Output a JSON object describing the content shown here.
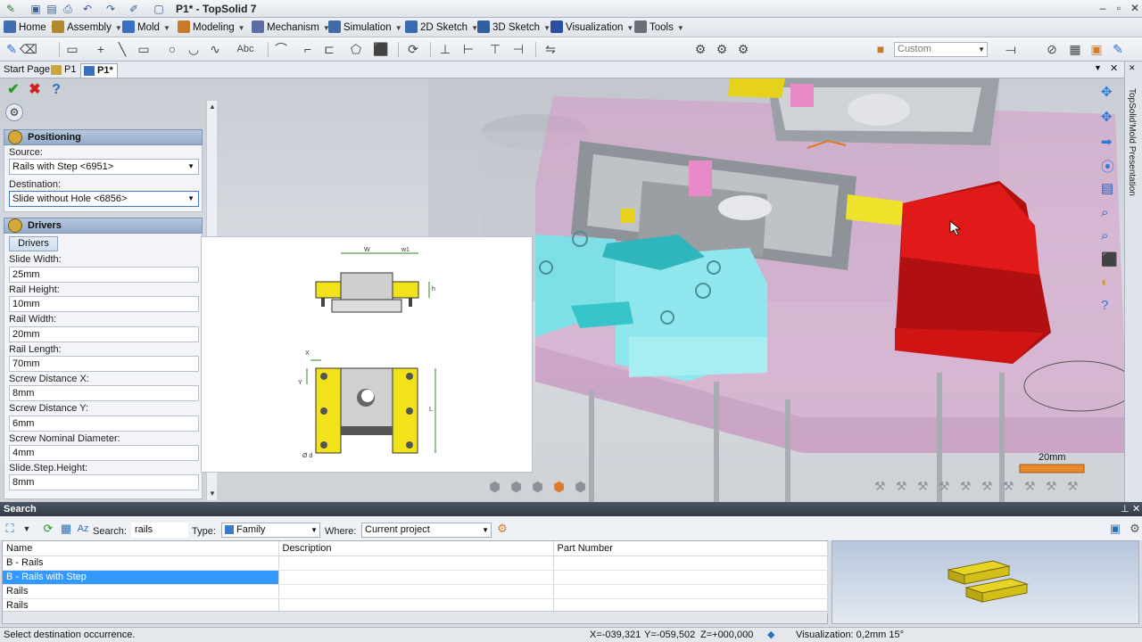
{
  "window": {
    "title": "P1* - TopSolid 7"
  },
  "menu": [
    {
      "label": "Home",
      "color": "#3f6fb0"
    },
    {
      "label": "Assembly",
      "color": "#b08a2c"
    },
    {
      "label": "Mold",
      "color": "#3a6fc2"
    },
    {
      "label": "Modeling",
      "color": "#c77a2a"
    },
    {
      "label": "Mechanism",
      "color": "#5a6fa6"
    },
    {
      "label": "Simulation",
      "color": "#406aa8"
    },
    {
      "label": "2D Sketch",
      "color": "#3a6ab0"
    },
    {
      "label": "3D Sketch",
      "color": "#2f5f9f"
    },
    {
      "label": "Visualization",
      "color": "#2a4ea0"
    },
    {
      "label": "Tools",
      "color": "#6a6f78"
    }
  ],
  "toolbar": {
    "view_style": "Custom"
  },
  "tabs": [
    {
      "label": "Start Page",
      "active": false
    },
    {
      "label": "P1",
      "active": false
    },
    {
      "label": "P1*",
      "active": true
    }
  ],
  "side_panel_label": "TopSolid'Mold Presentation",
  "positioning": {
    "header": "Positioning",
    "source_label": "Source:",
    "source_value": "Rails with Step <6951>",
    "destination_label": "Destination:",
    "destination_value": "Slide without Hole <6856>"
  },
  "drivers": {
    "header": "Drivers",
    "tab": "Drivers",
    "fields": [
      {
        "label": "Slide Width:",
        "value": "25mm"
      },
      {
        "label": "Rail Height:",
        "value": "10mm"
      },
      {
        "label": "Rail Width:",
        "value": "20mm"
      },
      {
        "label": "Rail Length:",
        "value": "70mm"
      },
      {
        "label": "Screw Distance X:",
        "value": "8mm"
      },
      {
        "label": "Screw Distance Y:",
        "value": "6mm"
      },
      {
        "label": "Screw Nominal Diameter:",
        "value": "4mm"
      },
      {
        "label": "Slide.Step.Height:",
        "value": "8mm"
      }
    ]
  },
  "drawing_labels": {
    "w": "W",
    "w1": "w1",
    "h": "h",
    "x": "X",
    "y": "Y",
    "l": "L",
    "d": "Ø d"
  },
  "scale_label": "20mm",
  "search": {
    "header": "Search",
    "search_label": "Search:",
    "search_value": "rails",
    "type_label": "Type:",
    "type_value": "Family",
    "where_label": "Where:",
    "where_value": "Current project",
    "columns": [
      "Name",
      "Description",
      "Part Number"
    ],
    "rows": [
      {
        "name": "B - Rails",
        "description": "",
        "part_number": "",
        "selected": false
      },
      {
        "name": "B - Rails with Step",
        "description": "",
        "part_number": "",
        "selected": true
      },
      {
        "name": "Rails",
        "description": "",
        "part_number": "",
        "selected": false
      },
      {
        "name": "Rails",
        "description": "",
        "part_number": "",
        "selected": false
      }
    ]
  },
  "status": {
    "message": "Select destination occurrence.",
    "x": "X=-039,321",
    "y": "Y=-059,502",
    "z": "Z=+000,000",
    "visualization": "Visualization: 0,2mm 15°"
  }
}
